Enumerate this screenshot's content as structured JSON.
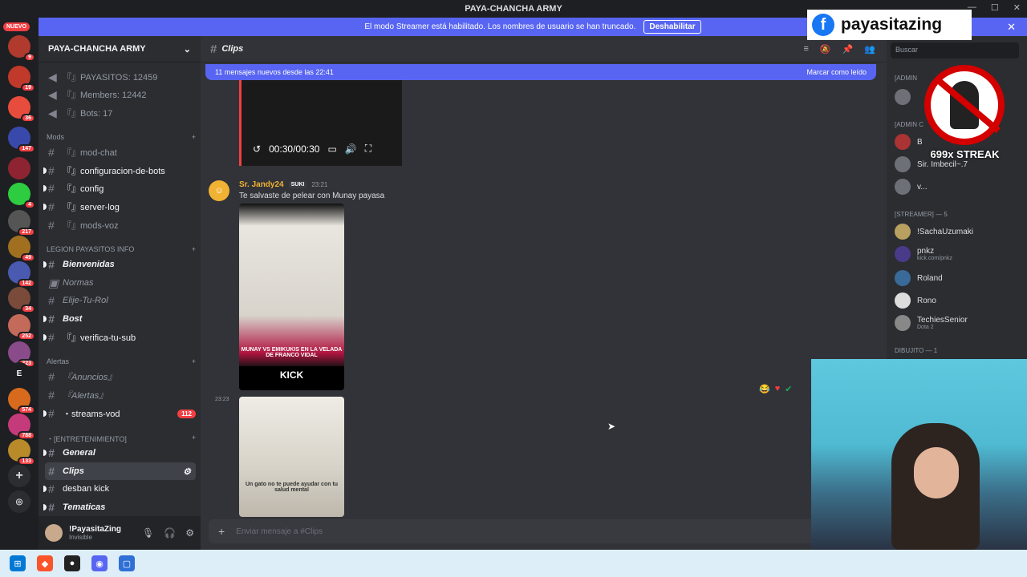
{
  "window": {
    "title": "PAYA-CHANCHA ARMY",
    "controls": [
      "—",
      "☐",
      "✕"
    ]
  },
  "servers": {
    "nuevo_label": "NUEVO",
    "letter_server": "E",
    "badges": [
      "9",
      "19",
      "36",
      "147",
      "4",
      "217",
      "49",
      "142",
      "34",
      "252",
      "223",
      "574",
      "788",
      "133"
    ]
  },
  "banner": {
    "text": "El modo Streamer está habilitado. Los nombres de usuario se han truncado.",
    "button": "Deshabilitar"
  },
  "guild": {
    "name": "PAYA-CHANCHA ARMY"
  },
  "channels": {
    "stats": [
      {
        "label": "『』PAYASITOS: 12459"
      },
      {
        "label": "『』Members: 12442"
      },
      {
        "label": "『』Bots: 17"
      }
    ],
    "cat_mods": "Mods",
    "mods": [
      {
        "label": "『』mod-chat"
      },
      {
        "label": "『』configuracion-de-bots"
      },
      {
        "label": "『』config"
      },
      {
        "label": "『』server-log"
      },
      {
        "label": "『』mods-voz"
      }
    ],
    "cat_legion": "LEGION PAYASITOS INFO",
    "legion": [
      {
        "label": "Bienvenidas"
      },
      {
        "label": "Normas"
      },
      {
        "label": "Elije-Tu-Rol"
      },
      {
        "label": "Bost"
      },
      {
        "label": "『』verifica-tu-sub"
      }
    ],
    "cat_alertas": "Alertas",
    "alertas": [
      {
        "label": "『Anuncios』"
      },
      {
        "label": "『Alertas』"
      },
      {
        "label": "・streams-vod",
        "badge": "112"
      }
    ],
    "cat_entre": "・[ENTRETENIMIENTO]",
    "entre": [
      {
        "label": "General"
      },
      {
        "label": "Clips"
      },
      {
        "label": "desban kick"
      },
      {
        "label": "Tematicas"
      }
    ]
  },
  "user": {
    "name": "!PayasitaZing",
    "status": "Invisible"
  },
  "chat": {
    "channel": "Clips",
    "new_messages": "11 mensajes nuevos desde las 22:41",
    "mark_read": "Marcar como leído",
    "video_time": "00:30/00:30",
    "message": {
      "author": "Sr. Jandy24",
      "tag": "SUKI",
      "time": "23:21",
      "text": "Te salvaste de pelear con Munay payasa"
    },
    "thumb1_caption": "MUNAY VS EMIKUKIS EN LA VELADA DE FRANCO VIDAL",
    "thumb1_brand": "KICK",
    "thumb2_caption": "Un gato no te puede ayudar con tu salud mental",
    "stamp": "23:23",
    "composer_placeholder": "Enviar mensaje a #Clips"
  },
  "members": {
    "search_placeholder": "Buscar",
    "cat_admin": "[ADMIN",
    "cat_admin2": "[ADMIN C",
    "admins": [
      "B",
      "Sir. Imbecil~.7",
      "v..."
    ],
    "cat_streamer": "[STREAMER] — 5",
    "streamers": [
      {
        "name": "!SachaUzumaki",
        "sub": ""
      },
      {
        "name": "pnkz",
        "sub": "kick.com/pnkz"
      },
      {
        "name": "Roland",
        "sub": ""
      },
      {
        "name": "Rono",
        "sub": ""
      },
      {
        "name": "TechiesSenior",
        "sub": "Dota 2"
      }
    ],
    "cat_dibujito": "DIBUJITO — 1"
  },
  "overlay": {
    "fb_name": "payasitazing",
    "streak": "699x STREAK"
  }
}
